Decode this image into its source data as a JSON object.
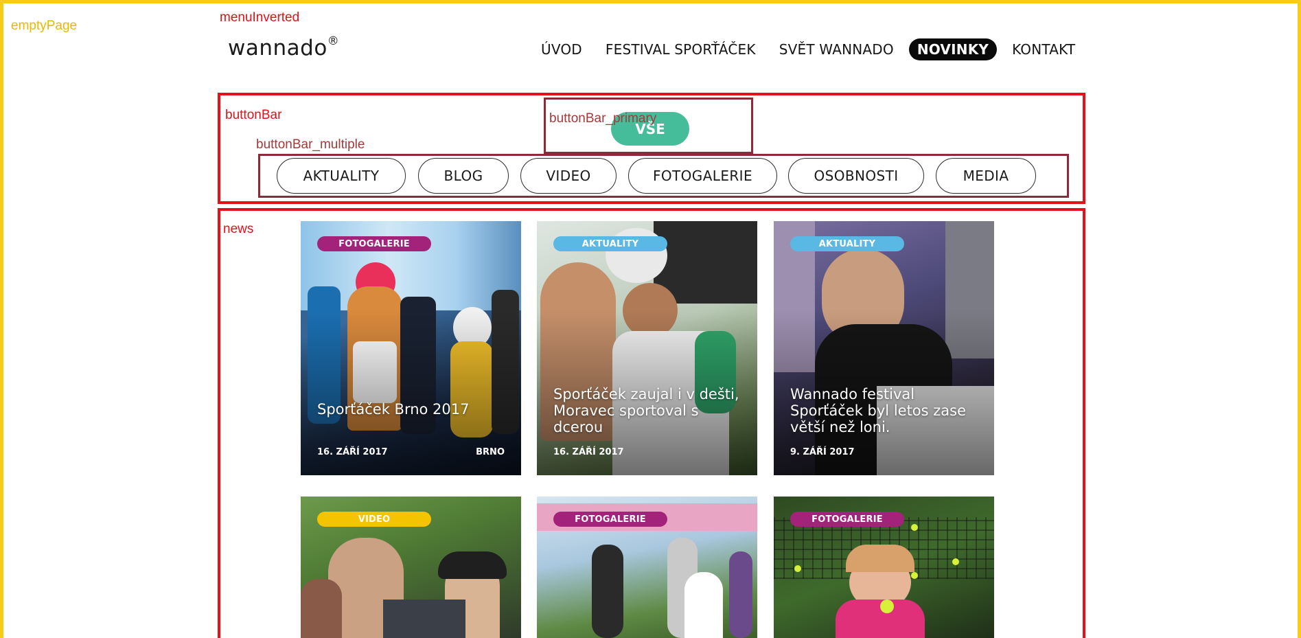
{
  "annotations": {
    "empty_page": "emptyPage",
    "menu_inverted": "menuInverted",
    "button_bar": "buttonBar",
    "button_bar_primary": "buttonBar_primary",
    "button_bar_multiple": "buttonBar_multiple",
    "news": "news"
  },
  "header": {
    "logo": "wannado",
    "logo_mark": "®",
    "nav": [
      {
        "label": "ÚVOD",
        "active": false
      },
      {
        "label": "FESTIVAL SPORŤÁČEK",
        "active": false
      },
      {
        "label": "SVĚT WANNADO",
        "active": false
      },
      {
        "label": "NOVINKY",
        "active": true
      },
      {
        "label": "KONTAKT",
        "active": false
      }
    ]
  },
  "button_bar": {
    "primary_label": "VŠE",
    "filters": [
      "AKTUALITY",
      "BLOG",
      "VIDEO",
      "FOTOGALERIE",
      "OSOBNOSTI",
      "MEDIA"
    ]
  },
  "news": {
    "cards": [
      {
        "badge": "FOTOGALERIE",
        "badge_color": "#a3237a",
        "title": "Sporťáček Brno 2017",
        "date": "16. ZÁŘÍ 2017",
        "place": "BRNO"
      },
      {
        "badge": "AKTUALITY",
        "badge_color": "#5ab8e4",
        "title": "Sporťáček zaujal i v dešti, Moravec sportoval s dcerou",
        "date": "16. ZÁŘÍ 2017",
        "place": ""
      },
      {
        "badge": "AKTUALITY",
        "badge_color": "#5ab8e4",
        "title": "Wannado festival Sporťáček byl letos zase větší než loni.",
        "date": "9. ZÁŘÍ 2017",
        "place": ""
      },
      {
        "badge": "VIDEO",
        "badge_color": "#f5c400",
        "title": "",
        "date": "",
        "place": ""
      },
      {
        "badge": "FOTOGALERIE",
        "badge_color": "#a3237a",
        "title": "",
        "date": "",
        "place": ""
      },
      {
        "badge": "FOTOGALERIE",
        "badge_color": "#a3237a",
        "title": "",
        "date": "",
        "place": ""
      }
    ]
  }
}
